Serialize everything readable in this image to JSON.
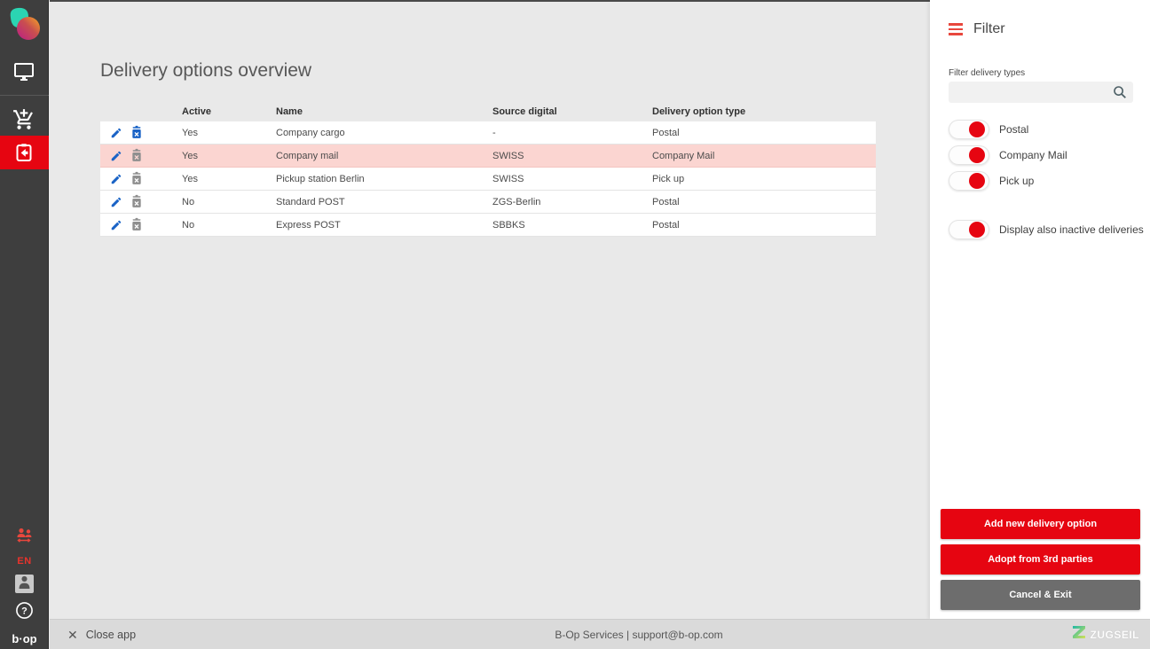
{
  "sidebar": {
    "language": "EN",
    "bop_logo_text": "b·op",
    "items": [
      {
        "icon": "monitor-icon",
        "active": false
      },
      {
        "icon": "add-cart-icon",
        "active": false
      },
      {
        "icon": "clipboard-return-icon",
        "active": true
      }
    ],
    "icons": [
      "app-logo",
      "monitor-icon",
      "add-cart-icon",
      "clipboard-return-icon",
      "user-transfer-icon",
      "avatar-icon",
      "help-icon"
    ]
  },
  "main": {
    "title": "Delivery options overview",
    "table": {
      "columns": [
        "Active",
        "Name",
        "Source digital",
        "Delivery option type"
      ],
      "rows": [
        {
          "active": "Yes",
          "name": "Company cargo",
          "source": "-",
          "type": "Postal",
          "highlighted": false,
          "delete_enabled": true
        },
        {
          "active": "Yes",
          "name": "Company mail",
          "source": "SWISS",
          "type": "Company Mail",
          "highlighted": true,
          "delete_enabled": false
        },
        {
          "active": "Yes",
          "name": "Pickup station Berlin",
          "source": "SWISS",
          "type": "Pick up",
          "highlighted": false,
          "delete_enabled": false
        },
        {
          "active": "No",
          "name": "Standard POST",
          "source": "ZGS-Berlin",
          "type": "Postal",
          "highlighted": false,
          "delete_enabled": false
        },
        {
          "active": "No",
          "name": "Express POST",
          "source": "SBBKS",
          "type": "Postal",
          "highlighted": false,
          "delete_enabled": false
        }
      ]
    }
  },
  "filter_panel": {
    "title": "Filter",
    "search_label": "Filter delivery types",
    "search_value": "",
    "toggles": [
      {
        "label": "Postal",
        "on": true
      },
      {
        "label": "Company Mail",
        "on": true
      },
      {
        "label": "Pick up",
        "on": true
      }
    ],
    "inactive_toggle": {
      "label": "Display also inactive deliveries",
      "on": true
    },
    "buttons": [
      {
        "label": "Add new delivery option",
        "style": "red"
      },
      {
        "label": "Adopt from 3rd parties",
        "style": "red"
      },
      {
        "label": "Cancel & Exit",
        "style": "gray"
      }
    ]
  },
  "footer": {
    "close_label": "Close app",
    "center_text": "B-Op Services | support@b-op.com",
    "brand": "ZUGSEIL"
  },
  "colors": {
    "accent_red": "#e60511",
    "coral_red": "#e8473d",
    "sidebar_bg": "#3e3e3e",
    "main_bg": "#e9e9e9",
    "panel_bg": "#ffffff",
    "footer_bg": "#dadada",
    "row_highlight": "#fbd5d1",
    "icon_blue": "#1a63c6",
    "icon_gray": "#8f8f8f",
    "logo_teal": "#2bd4b2",
    "logo_magenta": "#bb1d87",
    "logo_orange": "#f7a823"
  }
}
